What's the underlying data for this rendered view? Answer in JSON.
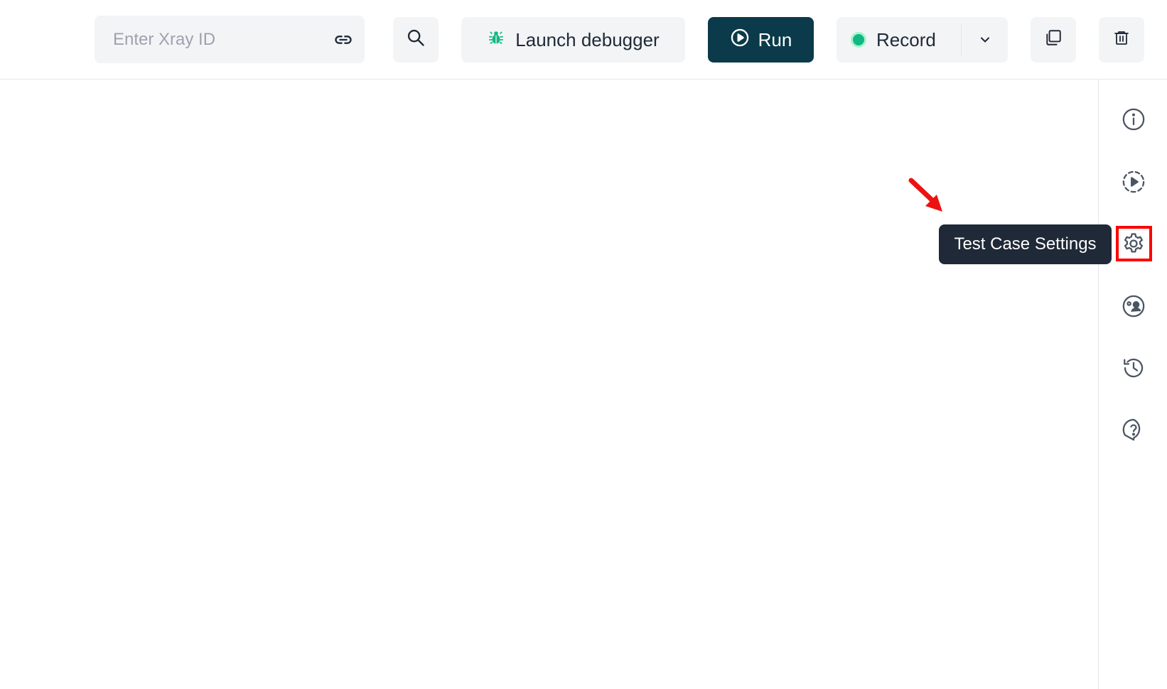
{
  "toolbar": {
    "xray_placeholder": "Enter Xray ID",
    "xray_value": "",
    "launch_debugger_label": "Launch debugger",
    "run_label": "Run",
    "record_label": "Record"
  },
  "tooltip": {
    "text": "Test Case Settings"
  },
  "rail": {
    "items": [
      {
        "name": "info-icon"
      },
      {
        "name": "play-dashed-icon"
      },
      {
        "name": "gear-icon"
      },
      {
        "name": "user-support-icon"
      },
      {
        "name": "history-icon"
      },
      {
        "name": "help-icon"
      }
    ]
  },
  "colors": {
    "run_button": "#0b3a4a",
    "record_dot": "#10b981",
    "bug_icon": "#10b981",
    "highlight": "#ff0000",
    "tooltip_bg": "#1f2937",
    "button_bg": "#f3f4f6"
  }
}
